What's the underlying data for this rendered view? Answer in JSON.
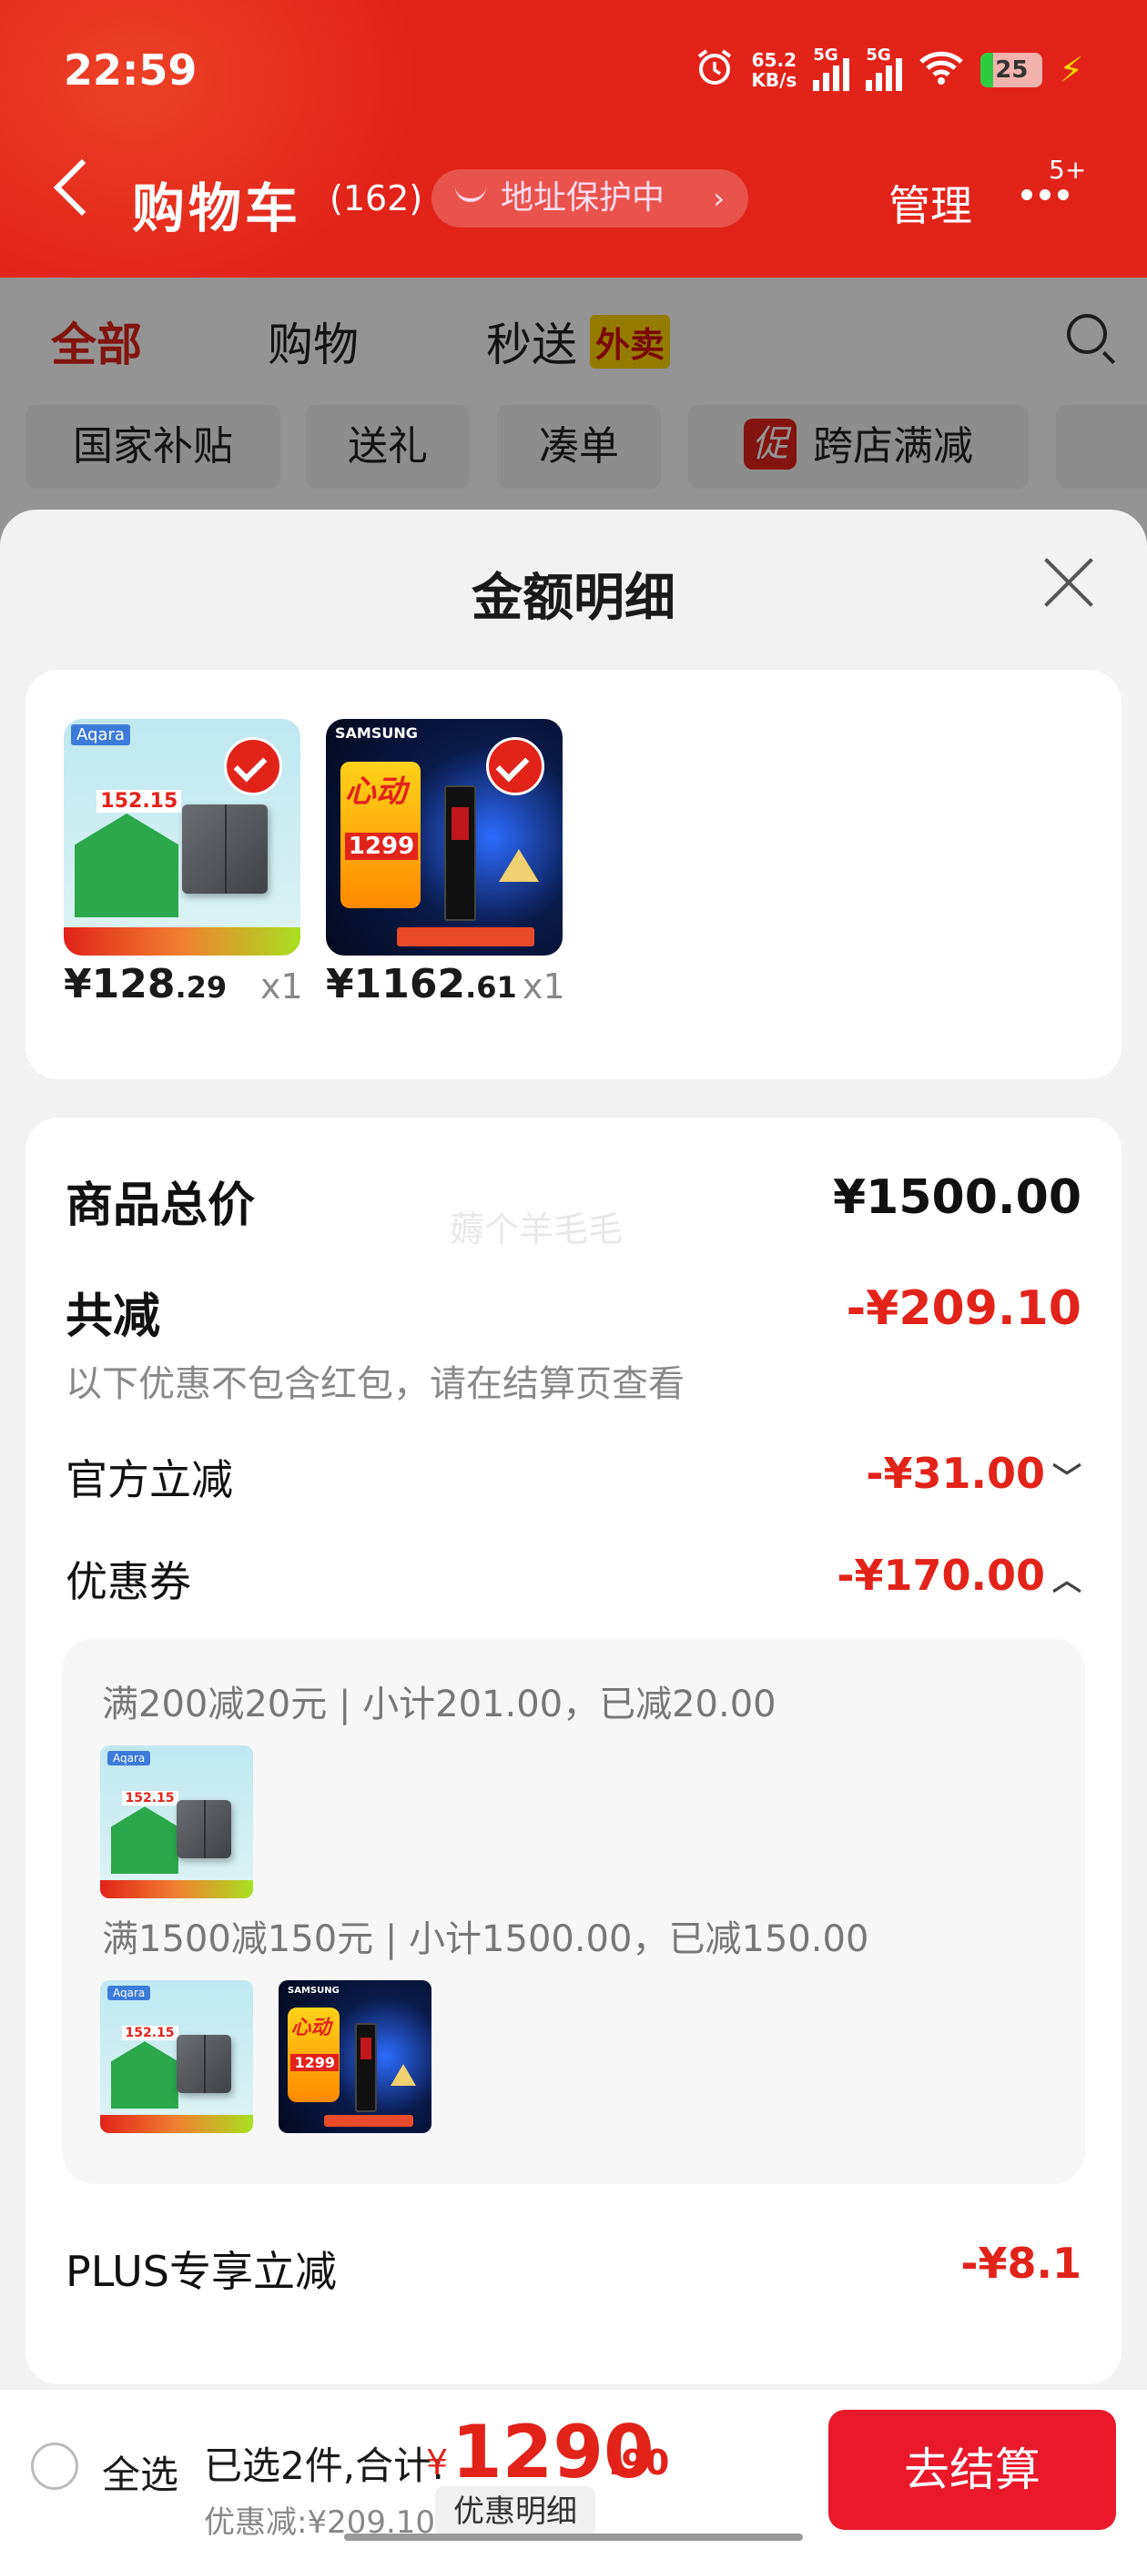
{
  "status": {
    "time": "22:59",
    "net_speed": "65.2",
    "net_unit": "KB/s",
    "sig1": "5G",
    "sig2": "5G",
    "battery": "25"
  },
  "nav": {
    "title": "购物车",
    "count": "(162)",
    "address_protect": "地址保护中",
    "manage": "管理",
    "badge": "5+"
  },
  "tabs": [
    {
      "label": "全部"
    },
    {
      "label": "购物"
    },
    {
      "label": "秒送"
    }
  ],
  "tab_badge": "外卖",
  "chips": [
    {
      "label": "国家补贴"
    },
    {
      "label": "送礼"
    },
    {
      "label": "凑单"
    },
    {
      "label": "跨店满减"
    }
  ],
  "chip_icon": "促",
  "sheet": {
    "title": "金额明细",
    "products": [
      {
        "price_int": "¥128",
        "price_dec": ".29",
        "qty": "x1",
        "name": "aqara-switch"
      },
      {
        "price_int": "¥1162",
        "price_dec": ".61",
        "qty": "x1",
        "name": "samsung-ssd"
      }
    ],
    "aqara_brand": "Aqara",
    "aqara_price": "152.15",
    "samsung_brand": "SAMSUNG",
    "samsung_promo": "心动",
    "samsung_price": "1299",
    "watermark": "薅个羊毛毛",
    "total_label": "商品总价",
    "total_value": "¥1500.00",
    "reduce_label": "共减",
    "reduce_value": "-¥209.10",
    "reduce_note": "以下优惠不包含红包，请在结算页查看",
    "official_label": "官方立减",
    "official_value": "-¥31.00",
    "coupon_label": "优惠券",
    "coupon_value": "-¥170.00",
    "coupon_lines": [
      "满200减20元 | 小计201.00，已减20.00",
      "满1500减150元 | 小计1500.00，已减150.00"
    ],
    "plus_label": "PLUS专享立减",
    "plus_value": "-¥8.1"
  },
  "bottom": {
    "select_all": "全选",
    "selected_text": "已选2件,合计:",
    "yen": "¥",
    "total_int": "1290",
    "total_dec": ".90",
    "discount": "优惠减:¥209.10",
    "detail_btn": "优惠明细",
    "checkout": "去结算"
  },
  "colors": {
    "brand_red": "#e2231a",
    "checkout_red": "#e9192a",
    "waimai_yellow": "#ffd400"
  }
}
